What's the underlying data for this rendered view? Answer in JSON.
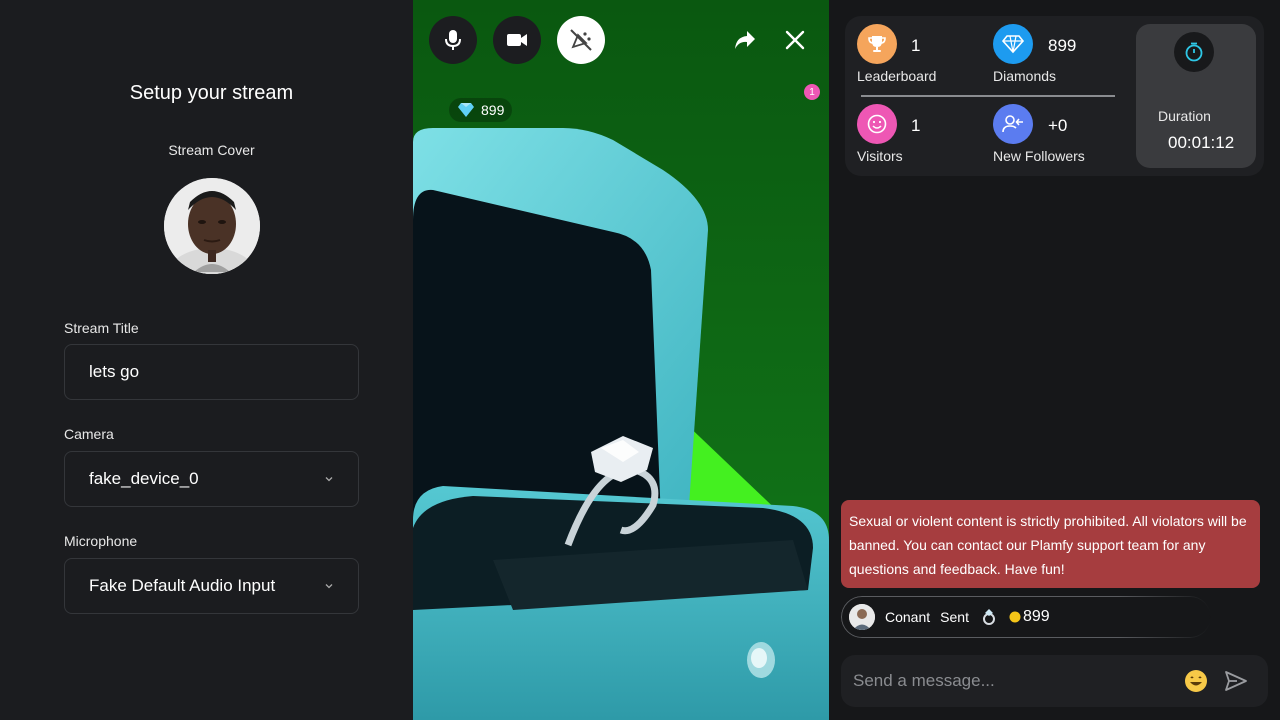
{
  "setup": {
    "title": "Setup your stream",
    "cover_label": "Stream Cover",
    "stream_title_label": "Stream Title",
    "stream_title_value": "lets go",
    "camera_label": "Camera",
    "camera_value": "fake_device_0",
    "microphone_label": "Microphone",
    "microphone_value": "Fake Default Audio Input"
  },
  "video": {
    "diamond_count": "899",
    "notification_count": "1",
    "controls": [
      "mic-icon",
      "video-camera-icon",
      "effects-off-icon",
      "share-icon",
      "close-icon"
    ]
  },
  "stats": {
    "leaderboard_value": "1",
    "leaderboard_label": "Leaderboard",
    "diamonds_value": "899",
    "diamonds_label": "Diamonds",
    "visitors_value": "1",
    "visitors_label": "Visitors",
    "followers_value": "+0",
    "followers_label": "New Followers",
    "duration_label": "Duration",
    "duration_value": "00:01:12"
  },
  "chat": {
    "warning": "Sexual or violent content is strictly prohibited. All violators will be banned. You can contact our Plamfy support team for any questions and feedback. Have fun!",
    "gift_user": "Conant",
    "gift_action": "Sent",
    "gift_amount": "899",
    "composer_placeholder": "Send a message..."
  },
  "colors": {
    "leaderboard": "#f5a55c",
    "diamonds": "#1d9bf0",
    "visitors": "#ee57b4",
    "followers": "#5b7cf0",
    "warning_bg": "#a63d3f",
    "video_green": "#0c6a14",
    "box_teal": "#4cc3cf"
  }
}
